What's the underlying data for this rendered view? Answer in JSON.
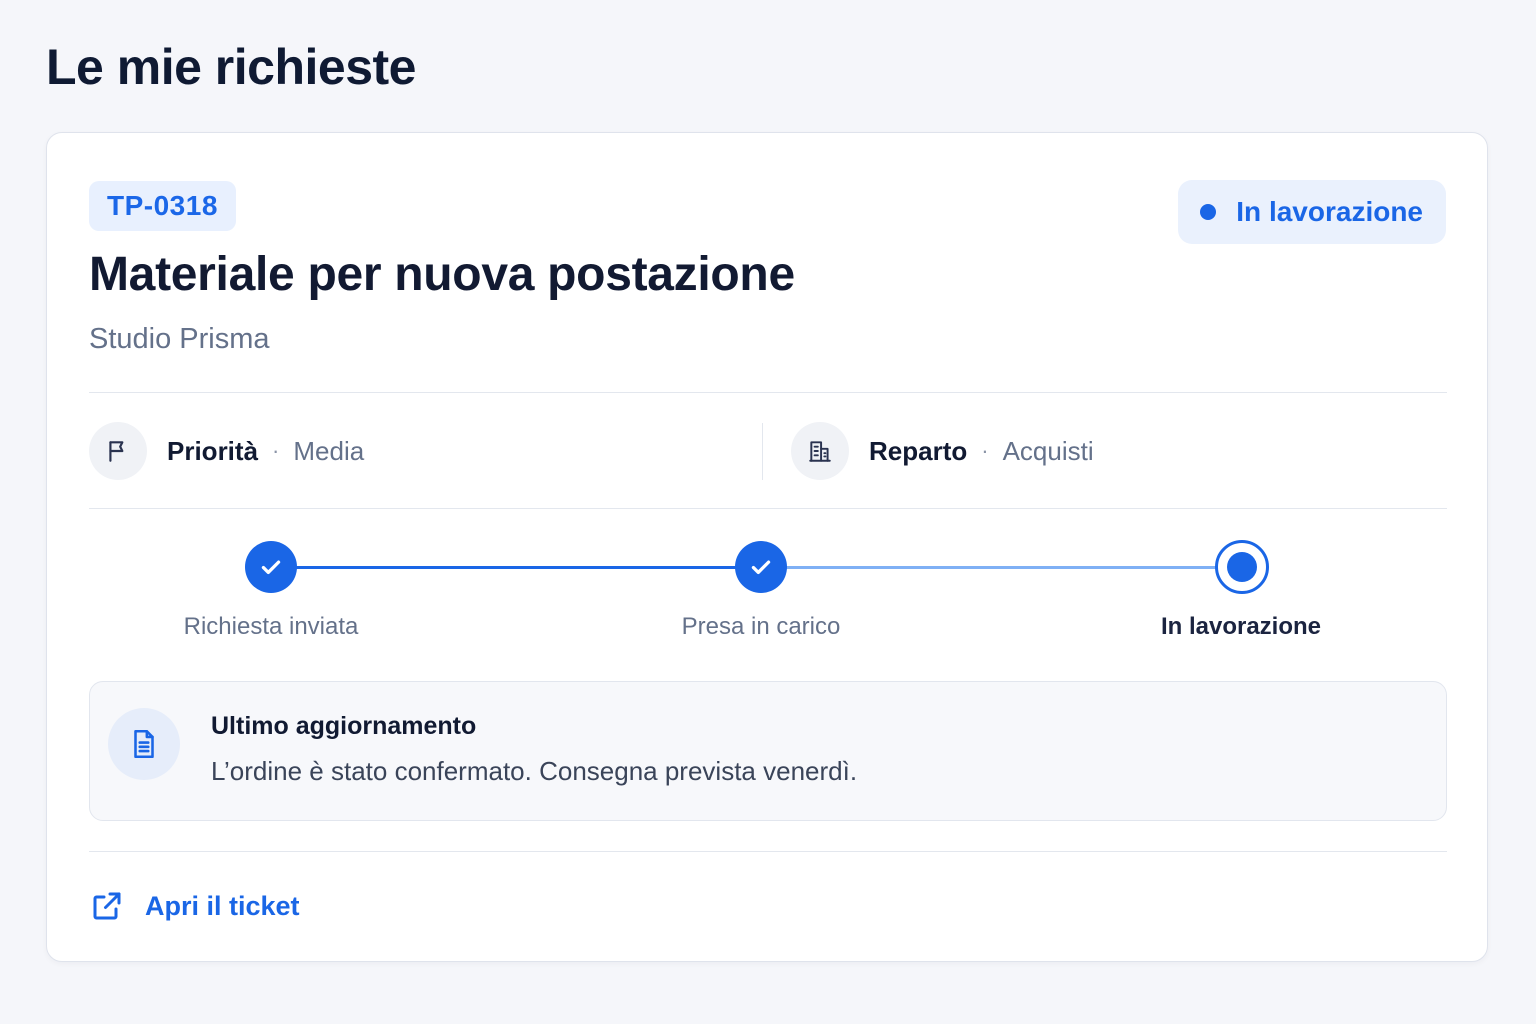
{
  "page": {
    "title": "Le mie richieste"
  },
  "ticket": {
    "id": "TP-0318",
    "status": "In lavorazione",
    "title": "Materiale per nuova postazione",
    "company": "Studio Prisma",
    "meta": {
      "priority_label": "Priorità",
      "priority_value": "Media",
      "department_label": "Reparto",
      "department_value": "Acquisti",
      "separator": "·"
    },
    "steps": [
      {
        "label": "Richiesta inviata",
        "state": "done"
      },
      {
        "label": "Presa in carico",
        "state": "done"
      },
      {
        "label": "In lavorazione",
        "state": "current"
      }
    ],
    "update": {
      "title": "Ultimo aggiornamento",
      "text": "L’ordine è stato confermato. Consegna prevista venerdì."
    },
    "action": {
      "open_label": "Apri il ticket"
    }
  },
  "icons": {
    "priority": "flag-icon",
    "department": "building-icon",
    "update": "document-icon",
    "open": "external-link-icon",
    "step_done": "check-icon"
  },
  "colors": {
    "accent": "#1a66e6",
    "accent_light": "#7fb0f5",
    "badge_bg": "#e8f0fe",
    "background": "#f5f6fa"
  }
}
